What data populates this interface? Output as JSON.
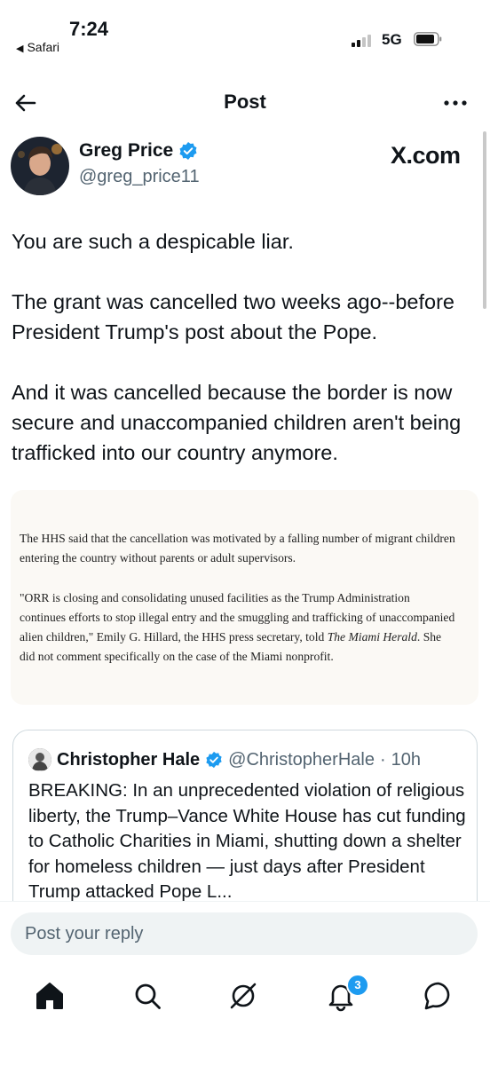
{
  "status_bar": {
    "time": "7:24",
    "back_app": "Safari",
    "network": "5G"
  },
  "nav": {
    "title": "Post",
    "back_icon": "arrow-left-icon",
    "more_icon": "more-horizontal-icon"
  },
  "post": {
    "author_name": "Greg Price",
    "author_handle": "@greg_price11",
    "source": "X.com",
    "paragraphs": [
      "You are such a despicable liar.",
      "The grant was cancelled two weeks ago--before President Trump's post about the Pope.",
      "And it was cancelled because the border is now secure and unaccompanied children aren't being trafficked into our country anymore."
    ]
  },
  "article_excerpt": {
    "p1": "The HHS said that the cancellation was motivated by a falling number of migrant children entering the country without parents or adult supervisors.",
    "p2_before": "\"ORR is closing and consolidating unused facilities as the Trump Administration continues efforts to stop illegal entry and the smuggling and trafficking of unaccompanied alien children,\" Emily G. Hillard, the HHS press secretary, told ",
    "p2_italic": "The Miami Herald",
    "p2_after": ". She did not comment specifically on the case of the Miami nonprofit."
  },
  "quoted_post": {
    "author_name": "Christopher Hale",
    "author_handle": "@ChristopherHale",
    "separator": "·",
    "time": "10h",
    "text": "BREAKING: In an unprecedented violation of religious liberty, the Trump–Vance White House has cut funding to Catholic Charities in Miami, shutting down a shelter for homeless children — just days after President Trump attacked Pope L..."
  },
  "reply": {
    "placeholder": "Post your reply"
  },
  "tabbar": {
    "items": [
      "home-icon",
      "search-icon",
      "grok-icon",
      "notifications-icon",
      "messages-icon"
    ],
    "notification_count": "3"
  },
  "colors": {
    "accent": "#1d9bf0",
    "text": "#0f1419",
    "secondary": "#536471"
  }
}
